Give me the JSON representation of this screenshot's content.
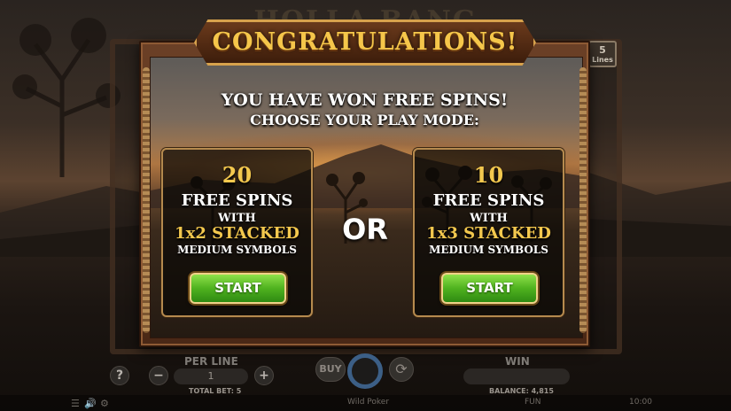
{
  "game": {
    "title_ghost": "HOLLA BANG",
    "lines_badge": {
      "value": "5",
      "label": "Lines"
    }
  },
  "dialog": {
    "banner": "CONGRATULATIONS!",
    "headline": "YOU HAVE WON FREE SPINS!",
    "subheadline": "CHOOSE YOUR PLAY MODE:",
    "separator": "OR",
    "modes": [
      {
        "count": "20",
        "free_spins": "FREE SPINS",
        "with": "WITH",
        "stacked": "1x2 STACKED",
        "medium": "MEDIUM SYMBOLS",
        "button": "START"
      },
      {
        "count": "10",
        "free_spins": "FREE SPINS",
        "with": "WITH",
        "stacked": "1x3 STACKED",
        "medium": "MEDIUM SYMBOLS",
        "button": "START"
      }
    ]
  },
  "hud": {
    "help": "?",
    "minus": "−",
    "plus": "+",
    "per_line_label": "PER LINE",
    "per_line_value": "1",
    "total_bet": "TOTAL BET: 5",
    "buy": "BUY",
    "win_label": "WIN",
    "balance": "BALANCE: 4,815",
    "status_game": "Wild Poker",
    "status_mode": "FUN",
    "status_time": "10:00"
  },
  "colors": {
    "gold_text": "#f3c84e",
    "start_green": "#4fb21f",
    "frame_brown": "#6b4026"
  }
}
